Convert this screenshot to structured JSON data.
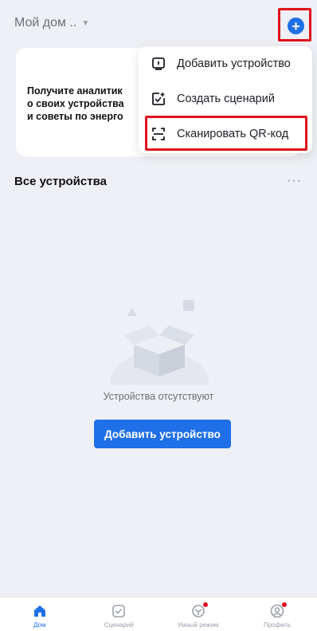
{
  "header": {
    "home_name": "Мой дом ..",
    "add_icon": "plus-circle-icon"
  },
  "promo": {
    "lines": [
      "Получите аналитик",
      "о своих устройства",
      "и советы по энерго"
    ]
  },
  "menu": {
    "items": [
      {
        "icon": "device-icon",
        "label": "Добавить устройство"
      },
      {
        "icon": "create-scenario-icon",
        "label": "Создать сценарий"
      },
      {
        "icon": "qr-scan-icon",
        "label": "Сканировать QR-код"
      }
    ]
  },
  "devices": {
    "section_title": "Все устройства",
    "more": "···",
    "empty_text": "Устройства отсутствуют",
    "add_button": "Добавить устройство"
  },
  "tabbar": {
    "items": [
      {
        "icon": "home-icon",
        "label": "Дом"
      },
      {
        "icon": "scenario-icon",
        "label": "Сценарий"
      },
      {
        "icon": "smart-mode-icon",
        "label": "Умный режим"
      },
      {
        "icon": "profile-icon",
        "label": "Профиль"
      }
    ]
  },
  "colors": {
    "accent": "#1f6fe8",
    "highlight": "#e0121b",
    "background": "#eef0f5"
  }
}
